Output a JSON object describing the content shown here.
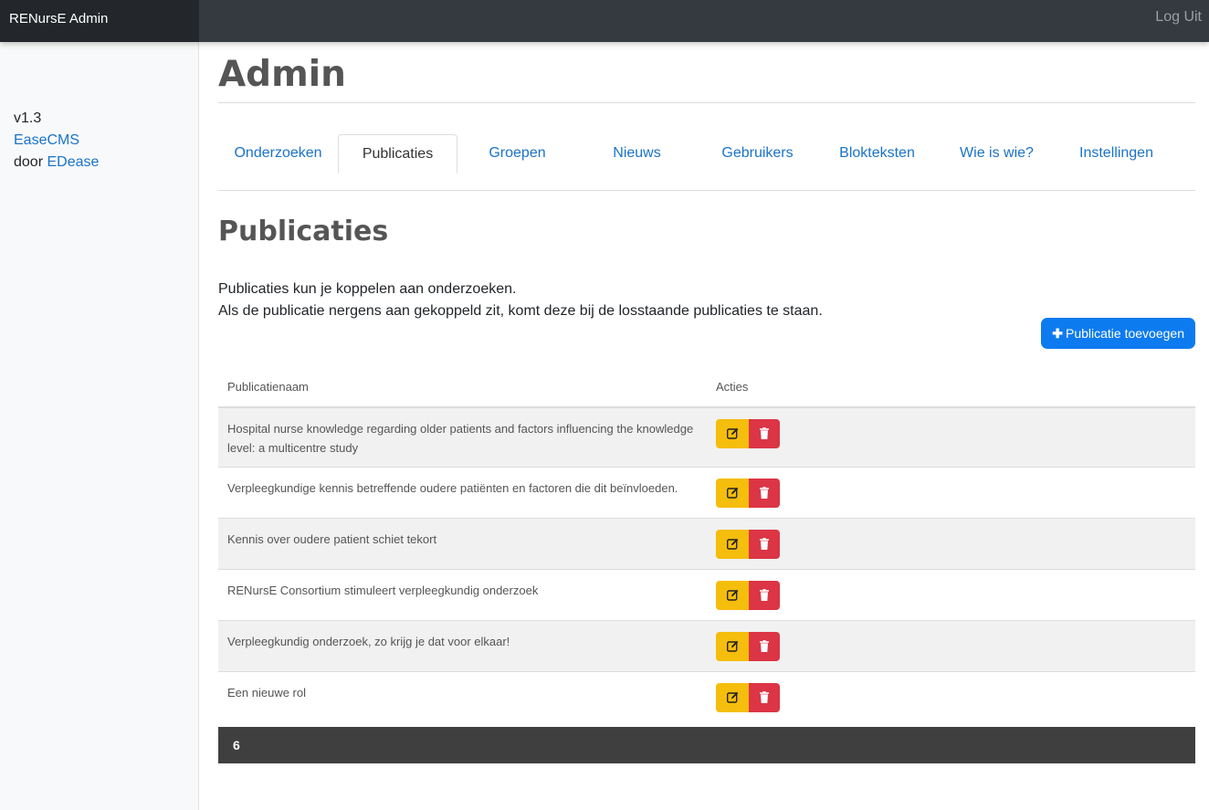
{
  "topbar": {
    "brand": "RENursE Admin",
    "logout": "Log Uit"
  },
  "sidebar": {
    "version": "v1.3",
    "cms_link": "EaseCMS",
    "by_text": "door",
    "author_link": "EDease"
  },
  "main": {
    "page_title": "Admin",
    "tabs": [
      {
        "label": "Onderzoeken",
        "active": false
      },
      {
        "label": "Publicaties",
        "active": true
      },
      {
        "label": "Groepen",
        "active": false
      },
      {
        "label": "Nieuws",
        "active": false
      },
      {
        "label": "Gebruikers",
        "active": false
      },
      {
        "label": "Blokteksten",
        "active": false
      },
      {
        "label": "Wie is wie?",
        "active": false
      },
      {
        "label": "Instellingen",
        "active": false
      }
    ],
    "section_title": "Publicaties",
    "description_line1": "Publicaties kun je koppelen aan onderzoeken.",
    "description_line2": "Als de publicatie nergens aan gekoppeld zit, komt deze bij de losstaande publicaties te staan.",
    "add_button": "Publicatie toevoegen",
    "table": {
      "headers": [
        "Publicatienaam",
        "Acties"
      ],
      "rows": [
        "Hospital nurse knowledge regarding older patients and factors influencing the knowledge level: a multicentre study",
        "Verpleegkundige kennis betreffende oudere patiënten en factoren die dit beïnvloeden.",
        "Kennis over oudere patient schiet tekort",
        "RENursE Consortium stimuleert verpleegkundig onderzoek",
        "Verpleegkundig onderzoek, zo krijg je dat voor elkaar!",
        "Een nieuwe rol"
      ]
    },
    "total_count": "6"
  },
  "icons": {
    "add": "plus-icon",
    "edit": "pen-square-icon",
    "delete": "trash-icon"
  },
  "colors": {
    "primary": "#0d7bf0",
    "edit": "#f5bd0c",
    "delete": "#dc3545",
    "topbar": "#343a40",
    "footer": "#3f3f3f"
  }
}
